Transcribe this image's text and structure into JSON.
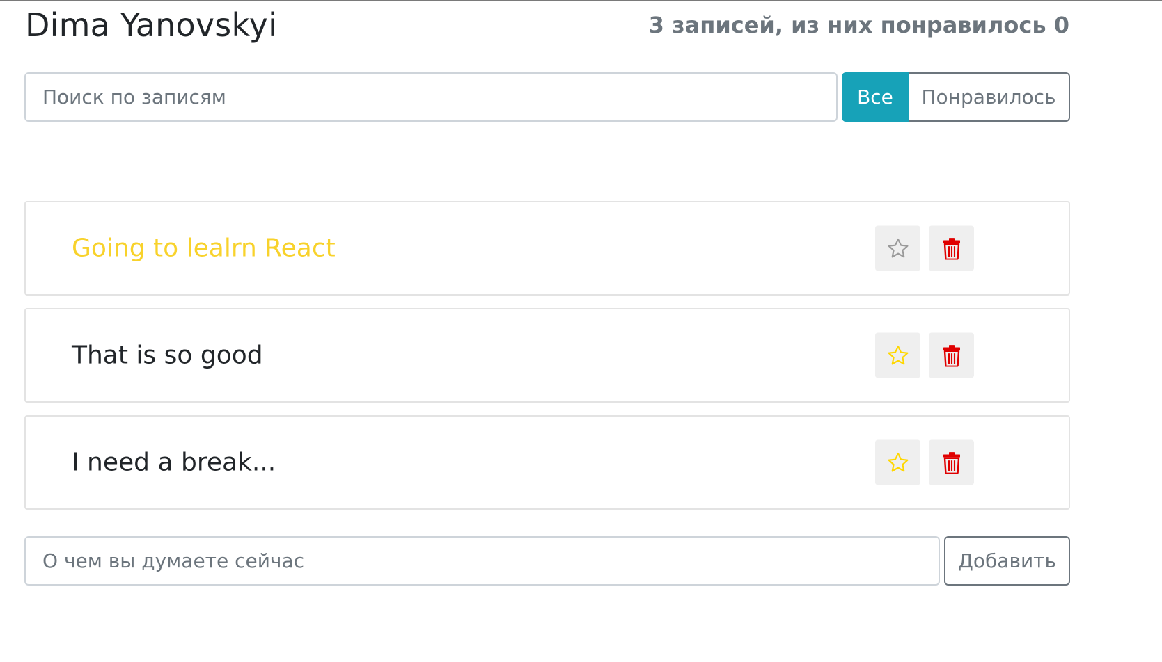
{
  "header": {
    "title": "Dima Yanovskyi",
    "counter": "3 записей, из них понравилось 0"
  },
  "search": {
    "placeholder": "Поиск по записям",
    "value": ""
  },
  "filters": {
    "all_label": "Все",
    "liked_label": "Понравилось",
    "active": "all"
  },
  "posts": [
    {
      "label": "Going to lealrn React",
      "important": true,
      "star_icon": "star-outline-icon",
      "delete_icon": "trash-icon"
    },
    {
      "label": "That is so good",
      "important": false,
      "star_icon": "star-outline-icon",
      "delete_icon": "trash-icon"
    },
    {
      "label": "I need a break...",
      "important": false,
      "star_icon": "star-outline-icon",
      "delete_icon": "trash-icon"
    }
  ],
  "add_form": {
    "placeholder": "О чем вы думаете сейчас",
    "value": "",
    "submit_label": "Добавить"
  },
  "colors": {
    "accent": "#17a2b8",
    "important_text": "#f8d22b",
    "star_gold": "#ffd700",
    "star_grey": "#9a9a9a",
    "delete_red": "#e00000",
    "muted": "#6c757d"
  }
}
